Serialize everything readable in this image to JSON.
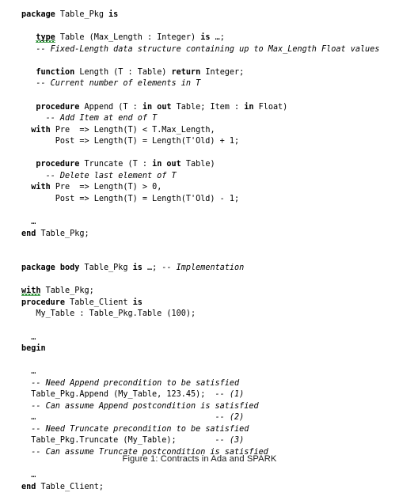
{
  "figure": {
    "caption": "Figure 1: Contracts in Ada and SPARK",
    "language": "Ada / SPARK",
    "background_color": "#ffffff",
    "text_color": "#000000",
    "squiggle_color": "#1f8a2a"
  },
  "code": {
    "lines": [
      {
        "id": "l01",
        "indent": 0,
        "text": "package Table_Pkg is"
      },
      {
        "id": "l02",
        "indent": 0,
        "text": ""
      },
      {
        "id": "l03",
        "indent": 3,
        "text": "type Table (Max_Length : Integer) is …;"
      },
      {
        "id": "l04",
        "indent": 3,
        "text": "-- Fixed-Length data structure containing up to Max_Length Float values"
      },
      {
        "id": "l05",
        "indent": 0,
        "text": ""
      },
      {
        "id": "l06",
        "indent": 3,
        "text": "function Length (T : Table) return Integer;"
      },
      {
        "id": "l07",
        "indent": 3,
        "text": "-- Current number of elements in T"
      },
      {
        "id": "l08",
        "indent": 0,
        "text": ""
      },
      {
        "id": "l09",
        "indent": 3,
        "text": "procedure Append (T : in out Table; Item : in Float)"
      },
      {
        "id": "l10",
        "indent": 5,
        "text": "-- Add Item at end of T"
      },
      {
        "id": "l11",
        "indent": 2,
        "text": "with Pre  => Length(T) < T.Max_Length,"
      },
      {
        "id": "l12",
        "indent": 7,
        "text": "Post => Length(T) = Length(T'Old) + 1;"
      },
      {
        "id": "l13",
        "indent": 0,
        "text": ""
      },
      {
        "id": "l14",
        "indent": 3,
        "text": "procedure Truncate (T : in out Table)"
      },
      {
        "id": "l15",
        "indent": 5,
        "text": "-- Delete last element of T"
      },
      {
        "id": "l16",
        "indent": 2,
        "text": "with Pre  => Length(T) > 0,"
      },
      {
        "id": "l17",
        "indent": 7,
        "text": "Post => Length(T) = Length(T'Old) - 1;"
      },
      {
        "id": "l18",
        "indent": 0,
        "text": ""
      },
      {
        "id": "l19",
        "indent": 2,
        "text": "…"
      },
      {
        "id": "l20",
        "indent": 0,
        "text": "end Table_Pkg;"
      },
      {
        "id": "l21",
        "indent": 0,
        "text": ""
      },
      {
        "id": "l22",
        "indent": 0,
        "text": ""
      },
      {
        "id": "l23",
        "indent": 0,
        "text": "package body Table_Pkg is …; -- Implementation"
      },
      {
        "id": "l24",
        "indent": 0,
        "text": ""
      },
      {
        "id": "l25",
        "indent": 0,
        "text": "with Table_Pkg;"
      },
      {
        "id": "l26",
        "indent": 0,
        "text": "procedure Table_Client is"
      },
      {
        "id": "l27",
        "indent": 3,
        "text": "My_Table : Table_Pkg.Table (100);"
      },
      {
        "id": "l28",
        "indent": 0,
        "text": ""
      },
      {
        "id": "l29",
        "indent": 2,
        "text": "…"
      },
      {
        "id": "l30",
        "indent": 0,
        "text": "begin"
      },
      {
        "id": "l31",
        "indent": 0,
        "text": ""
      },
      {
        "id": "l32",
        "indent": 2,
        "text": "…"
      },
      {
        "id": "l33",
        "indent": 2,
        "text": "-- Need Append precondition to be satisfied"
      },
      {
        "id": "l34",
        "indent": 2,
        "text": "Table_Pkg.Append (My_Table, 123.45);  -- (1)"
      },
      {
        "id": "l35",
        "indent": 2,
        "text": "-- Can assume Append postcondition is satisfied"
      },
      {
        "id": "l36",
        "indent": 2,
        "text": "…                                     -- (2)"
      },
      {
        "id": "l37",
        "indent": 2,
        "text": "-- Need Truncate precondition to be satisfied"
      },
      {
        "id": "l38",
        "indent": 2,
        "text": "Table_Pkg.Truncate (My_Table);        -- (3)"
      },
      {
        "id": "l39",
        "indent": 2,
        "text": "-- Can assume Truncate postcondition is satisfied"
      },
      {
        "id": "l40",
        "indent": 0,
        "text": ""
      },
      {
        "id": "l41",
        "indent": 2,
        "text": "…"
      },
      {
        "id": "l42",
        "indent": 0,
        "text": "end Table_Client;"
      }
    ],
    "keywords_bold": [
      "package",
      "body",
      "is",
      "type",
      "function",
      "return",
      "procedure",
      "in",
      "out",
      "with",
      "end",
      "begin"
    ],
    "spellcheck_underlined_tokens": [
      "type",
      "with"
    ],
    "comment_markers": [
      "--"
    ],
    "annotations": [
      "-- (1)",
      "-- (2)",
      "-- (3)"
    ],
    "identifiers": [
      "Table_Pkg",
      "Table",
      "Max_Length",
      "Integer",
      "Float",
      "Length",
      "T",
      "Append",
      "Item",
      "Truncate",
      "Pre",
      "Post",
      "T'Old",
      "Table_Client",
      "My_Table"
    ],
    "literals": [
      "123.45",
      "100",
      "0",
      "1"
    ]
  }
}
